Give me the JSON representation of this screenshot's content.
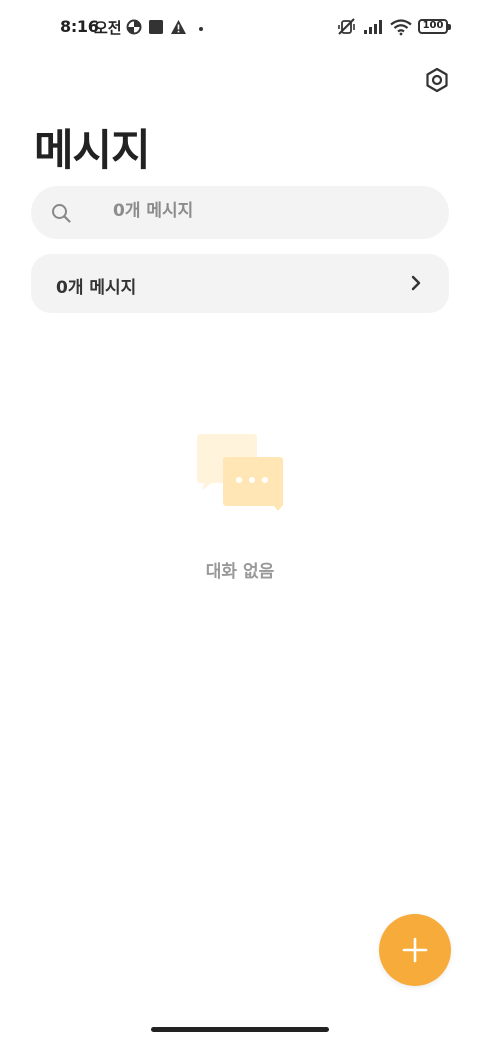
{
  "status_bar": {
    "time": "8:16",
    "ampm": "오전",
    "battery": "100",
    "icons": [
      "data-saver-icon",
      "square-notification-icon",
      "warning-icon",
      "dot-icon",
      "mute-icon",
      "signal-icon",
      "wifi-icon",
      "battery-icon"
    ]
  },
  "header": {
    "title": "메시지",
    "settings_icon": "settings-icon"
  },
  "search": {
    "placeholder": "0개 메시지",
    "icon": "search-icon"
  },
  "count_row": {
    "label": "0개 메시지",
    "icon": "chevron-right-icon"
  },
  "empty_state": {
    "text": "대화 없음",
    "icon": "chat-bubbles-icon"
  },
  "fab": {
    "icon": "plus-icon"
  },
  "colors": {
    "accent": "#f7ab3a",
    "surface": "#f3f3f3",
    "illustration_light": "#fff3dc",
    "illustration_mid": "#ffe6b4"
  }
}
